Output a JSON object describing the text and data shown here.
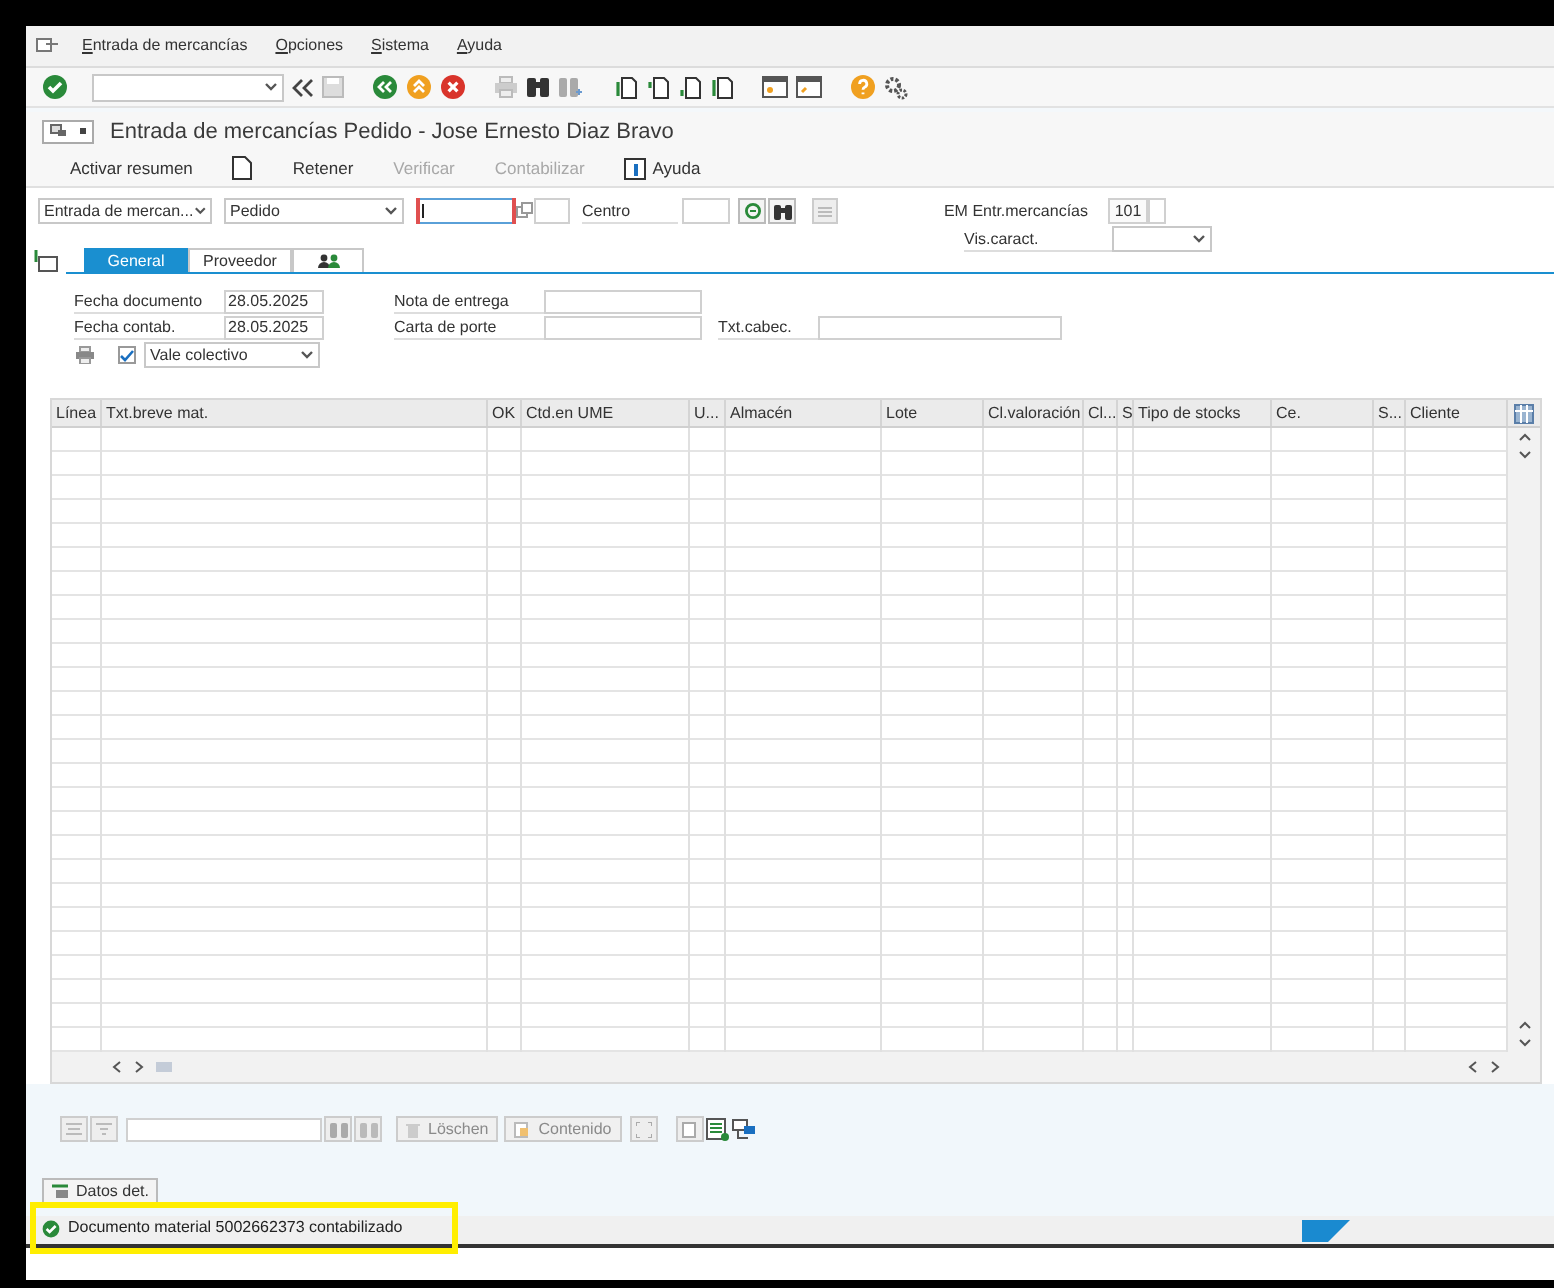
{
  "menu_bar": [
    {
      "label": "Entrada de mercancías"
    },
    {
      "label": "Opciones"
    },
    {
      "label": "Sistema"
    },
    {
      "label": "Ayuda"
    }
  ],
  "title": "Entrada de mercancías Pedido - Jose Ernesto Diaz Bravo",
  "app_toolbar": [
    {
      "kind": "text",
      "label": "Activar resumen",
      "disabled": false
    },
    {
      "kind": "page"
    },
    {
      "kind": "text",
      "label": "Retener",
      "disabled": false
    },
    {
      "kind": "text",
      "label": "Verificar",
      "disabled": true
    },
    {
      "kind": "text",
      "label": "Contabilizar",
      "disabled": true
    },
    {
      "kind": "help",
      "label": "Ayuda",
      "disabled": false
    }
  ],
  "selection": {
    "transaction": "Entrada de mercan...",
    "reference": "Pedido",
    "order": {
      "focused": true
    },
    "plant_label": "Centro",
    "movement_label": "EM Entr.mercancías",
    "movement_value": "101",
    "view_label": "Vis.caract."
  },
  "tabs": [
    {
      "kind": "text",
      "label": "General",
      "selected": true
    },
    {
      "kind": "text",
      "label": "Proveedor",
      "selected": false
    },
    {
      "kind": "icon",
      "selected": false
    }
  ],
  "header": {
    "doc_date_label": "Fecha documento",
    "doc_date": "28.05.2025",
    "post_date_label": "Fecha contab.",
    "post_date": "28.05.2025",
    "delivery_note_label": "Nota de entrega",
    "bill_label": "Carta de porte",
    "header_text_label": "Txt.cabec.",
    "collective_slip": {
      "checked": true,
      "value": "Vale colectivo"
    }
  },
  "table": {
    "columns": [
      "Línea",
      "Txt.breve mat.",
      "OK",
      "Ctd.en UME",
      "U...",
      "Almacén",
      "Lote",
      "Cl.valoración",
      "Cl...",
      "S",
      "Tipo de stocks",
      "Ce.",
      "S...",
      "Cliente"
    ]
  },
  "bottom_toolbar": [
    {
      "label": "Löschen",
      "disabled": true
    },
    {
      "label": "Contenido",
      "disabled": true
    }
  ],
  "detail_tab": {
    "label": "Datos det."
  },
  "status_bar": {
    "kind": "success",
    "message": "Documento material 5002662373 contabilizado",
    "highlighted": true
  }
}
